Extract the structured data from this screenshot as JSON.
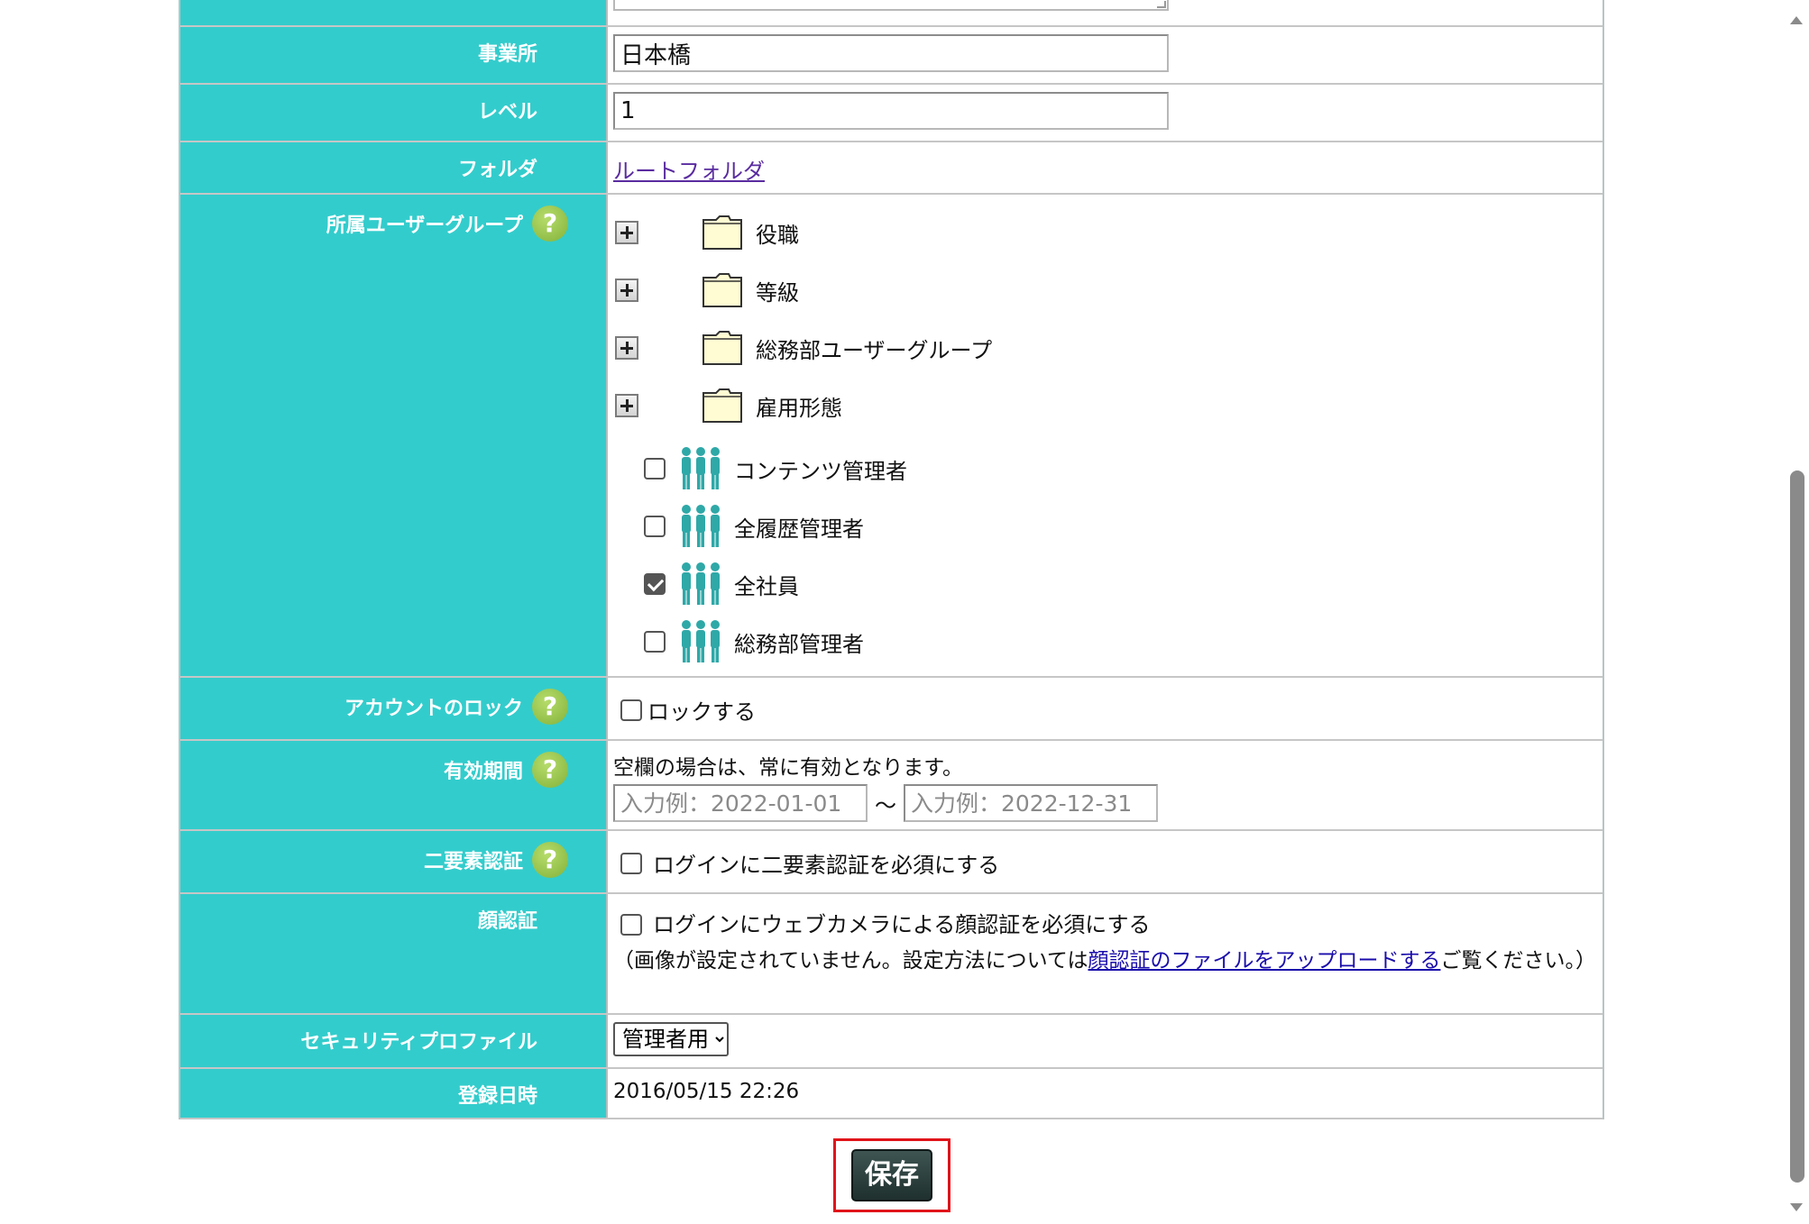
{
  "form": {
    "office": {
      "label": "事業所",
      "value": "日本橋"
    },
    "level": {
      "label": "レベル",
      "value": "1"
    },
    "folder": {
      "label": "フォルダ",
      "link": "ルートフォルダ"
    },
    "groups": {
      "label": "所属ユーザーグループ",
      "folders": [
        {
          "name": "役職"
        },
        {
          "name": "等級"
        },
        {
          "name": "総務部ユーザーグループ"
        },
        {
          "name": "雇用形態"
        }
      ],
      "items": [
        {
          "name": "コンテンツ管理者",
          "checked": false
        },
        {
          "name": "全履歴管理者",
          "checked": false
        },
        {
          "name": "全社員",
          "checked": true
        },
        {
          "name": "総務部管理者",
          "checked": false
        }
      ]
    },
    "lock": {
      "label": "アカウントのロック",
      "checkbox_label": "ロックする",
      "checked": false
    },
    "validity": {
      "label": "有効期間",
      "note": "空欄の場合は、常に有効となります。",
      "from_placeholder": "入力例：2022-01-01",
      "to_placeholder": "入力例：2022-12-31",
      "separator": "～"
    },
    "two_factor": {
      "label": "二要素認証",
      "checkbox_label": "ログインに二要素認証を必須にする",
      "checked": false
    },
    "face": {
      "label": "顔認証",
      "checkbox_label": "ログインにウェブカメラによる顔認証を必須にする",
      "note_prefix": "（画像が設定されていません。設定方法については",
      "note_link": "顔認証のファイルをアップロードする",
      "note_suffix": "ご覧ください。）",
      "checked": false
    },
    "security_profile": {
      "label": "セキュリティプロファイル",
      "selected": "管理者用"
    },
    "registered": {
      "label": "登録日時",
      "value": "2016/05/15 22:26"
    }
  },
  "save_button": {
    "label": "保存"
  },
  "colors": {
    "label_bg": "#33cccc",
    "help_icon": "#8cc43f",
    "save_button": "#2d403e",
    "highlight_frame": "#e0141a"
  }
}
